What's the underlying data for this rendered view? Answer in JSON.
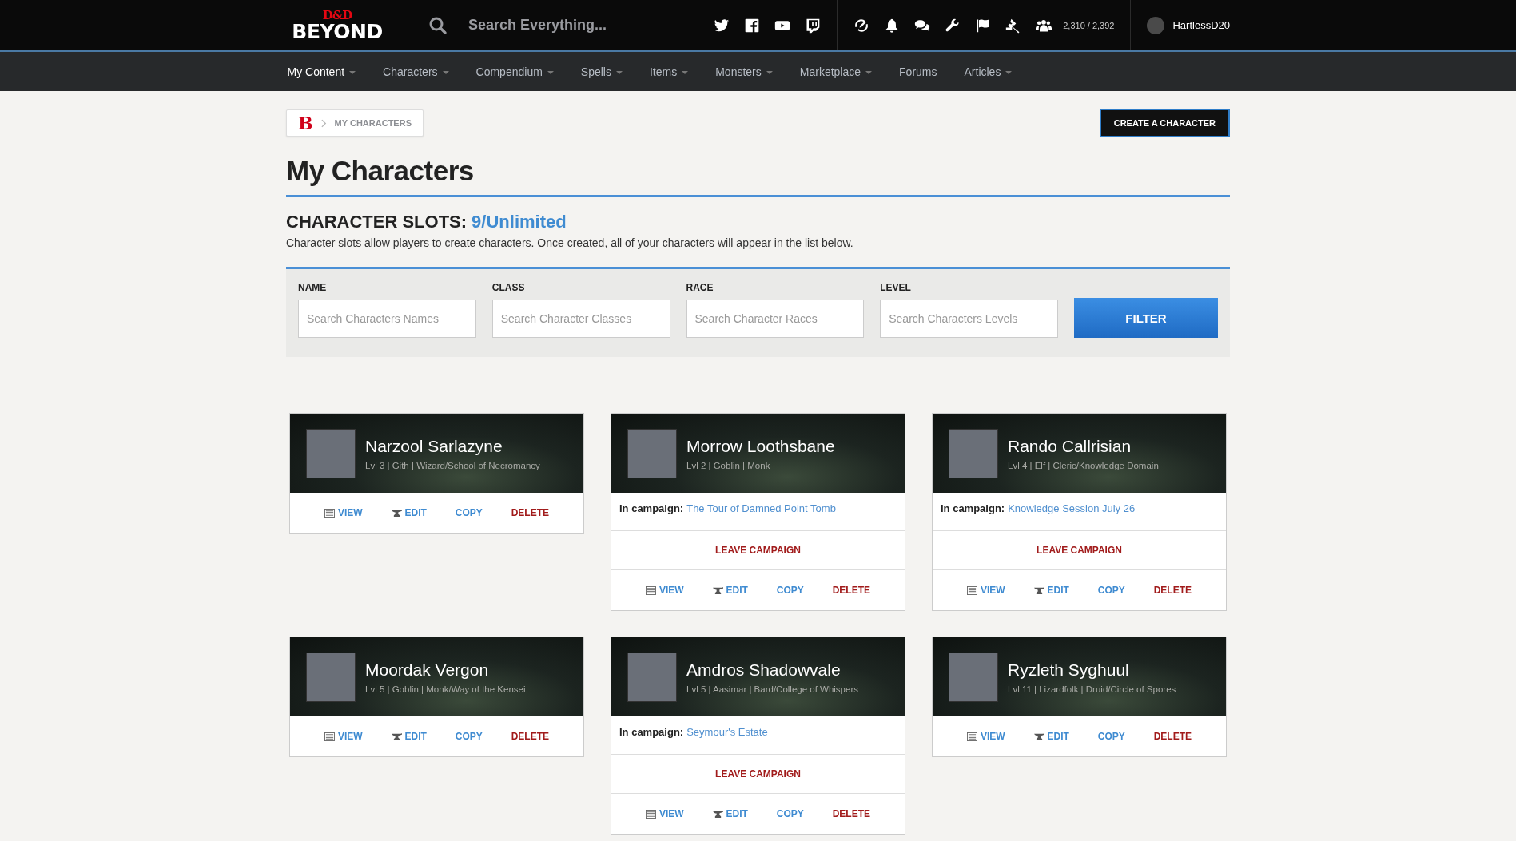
{
  "header": {
    "logo": {
      "mark": "D&D",
      "wordmark": "BEYOND"
    },
    "search": {
      "placeholder": "Search Everything..."
    },
    "social": [
      {
        "kind": "twitter"
      },
      {
        "kind": "facebook"
      },
      {
        "kind": "youtube"
      },
      {
        "kind": "twitch"
      }
    ],
    "tools": [
      {
        "kind": "sync"
      },
      {
        "kind": "bell"
      },
      {
        "kind": "chat"
      },
      {
        "kind": "wrench"
      },
      {
        "kind": "flag"
      },
      {
        "kind": "gavel"
      },
      {
        "kind": "users"
      }
    ],
    "counter": "2,310 / 2,392",
    "user": {
      "name": "HartlessD20"
    }
  },
  "nav": [
    {
      "label": "My Content",
      "selected": true,
      "dropdown": true
    },
    {
      "label": "Characters",
      "selected": false,
      "dropdown": true
    },
    {
      "label": "Compendium",
      "selected": false,
      "dropdown": true
    },
    {
      "label": "Spells",
      "selected": false,
      "dropdown": true
    },
    {
      "label": "Items",
      "selected": false,
      "dropdown": true
    },
    {
      "label": "Monsters",
      "selected": false,
      "dropdown": true
    },
    {
      "label": "Marketplace",
      "selected": false,
      "dropdown": true
    },
    {
      "label": "Forums",
      "selected": false,
      "dropdown": false
    },
    {
      "label": "Articles",
      "selected": false,
      "dropdown": true
    }
  ],
  "breadcrumb": {
    "home": "B",
    "current": "MY CHARACTERS"
  },
  "create_button": "CREATE A CHARACTER",
  "title": "My Characters",
  "slots": {
    "label": "CHARACTER SLOTS:",
    "value": "9/Unlimited",
    "description": "Character slots allow players to create characters. Once created, all of your characters will appear in the list below."
  },
  "filters": [
    {
      "label": "NAME",
      "placeholder": "Search Characters Names"
    },
    {
      "label": "CLASS",
      "placeholder": "Search Character Classes"
    },
    {
      "label": "RACE",
      "placeholder": "Search Character Races"
    },
    {
      "label": "LEVEL",
      "placeholder": "Search Characters Levels"
    }
  ],
  "filter_button": "FILTER",
  "characters": [
    {
      "name": "Narzool Sarlazyne",
      "summary": "Lvl 3 | Gith | Wizard/School of Necromancy",
      "actions": [
        {
          "kind": "view",
          "label": "VIEW"
        },
        {
          "kind": "edit",
          "label": "EDIT"
        },
        {
          "kind": "copy",
          "label": "COPY"
        },
        {
          "kind": "delete",
          "label": "DELETE"
        }
      ]
    },
    {
      "name": "Morrow Loothsbane",
      "summary": "Lvl 2 | Goblin | Monk",
      "campaign": {
        "label": "In campaign:",
        "name": "The Tour of Damned Point Tomb",
        "leave": "LEAVE CAMPAIGN"
      },
      "actions": [
        {
          "kind": "view",
          "label": "VIEW"
        },
        {
          "kind": "edit",
          "label": "EDIT"
        },
        {
          "kind": "copy",
          "label": "COPY"
        },
        {
          "kind": "delete",
          "label": "DELETE"
        }
      ]
    },
    {
      "name": "Rando Callrisian",
      "summary": "Lvl 4 | Elf | Cleric/Knowledge Domain",
      "campaign": {
        "label": "In campaign:",
        "name": "Knowledge Session July 26",
        "leave": "LEAVE CAMPAIGN"
      },
      "actions": [
        {
          "kind": "view",
          "label": "VIEW"
        },
        {
          "kind": "edit",
          "label": "EDIT"
        },
        {
          "kind": "copy",
          "label": "COPY"
        },
        {
          "kind": "delete",
          "label": "DELETE"
        }
      ]
    },
    {
      "name": "Moordak Vergon",
      "summary": "Lvl 5 | Goblin | Monk/Way of the Kensei",
      "actions": [
        {
          "kind": "view",
          "label": "VIEW"
        },
        {
          "kind": "edit",
          "label": "EDIT"
        },
        {
          "kind": "copy",
          "label": "COPY"
        },
        {
          "kind": "delete",
          "label": "DELETE"
        }
      ]
    },
    {
      "name": "Amdros Shadowvale",
      "summary": "Lvl 5 | Aasimar | Bard/College of Whispers",
      "campaign": {
        "label": "In campaign:",
        "name": "Seymour's Estate",
        "leave": "LEAVE CAMPAIGN"
      },
      "actions": [
        {
          "kind": "view",
          "label": "VIEW"
        },
        {
          "kind": "edit",
          "label": "EDIT"
        },
        {
          "kind": "copy",
          "label": "COPY"
        },
        {
          "kind": "delete",
          "label": "DELETE"
        }
      ]
    },
    {
      "name": "Ryzleth Syghuul",
      "summary": "Lvl 11 | Lizardfolk | Druid/Circle of Spores",
      "actions": [
        {
          "kind": "view",
          "label": "VIEW"
        },
        {
          "kind": "edit",
          "label": "EDIT"
        },
        {
          "kind": "copy",
          "label": "COPY"
        },
        {
          "kind": "delete",
          "label": "DELETE"
        }
      ]
    }
  ]
}
